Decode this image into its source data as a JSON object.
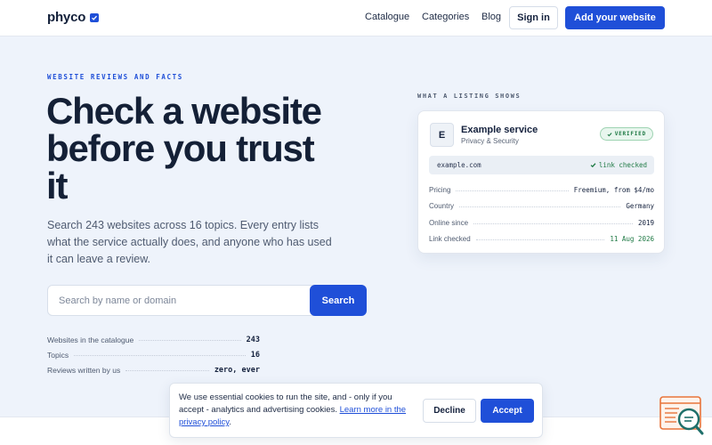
{
  "header": {
    "logo_text": "phyco",
    "nav": [
      "Catalogue",
      "Categories",
      "Blog"
    ],
    "signin_label": "Sign in",
    "add_label": "Add your website"
  },
  "hero": {
    "eyebrow": "WEBSITE REVIEWS AND FACTS",
    "title": "Check a website before you trust it",
    "subtitle": "Search 243 websites across 16 topics. Every entry lists what the service actually does, and anyone who has used it can leave a review.",
    "search_placeholder": "Search by name or domain",
    "search_button": "Search",
    "stats": [
      {
        "label": "Websites in the catalogue",
        "value": "243"
      },
      {
        "label": "Topics",
        "value": "16"
      },
      {
        "label": "Reviews written by us",
        "value": "zero, ever"
      }
    ]
  },
  "listing": {
    "eyebrow": "WHAT A LISTING SHOWS",
    "avatar_letter": "E",
    "name": "Example service",
    "category": "Privacy & Security",
    "badge": "VERIFIED",
    "url": "example.com",
    "url_status": "link checked",
    "facts": [
      {
        "label": "Pricing",
        "value": "Freemium, from $4/mo"
      },
      {
        "label": "Country",
        "value": "Germany"
      },
      {
        "label": "Online since",
        "value": "2019"
      },
      {
        "label": "Link checked",
        "value": "11 Aug 2026"
      }
    ]
  },
  "cookie": {
    "text_before": "We use essential cookies to run the site, and - only if you accept - analytics and advertising cookies. ",
    "link_text": "Learn more in the privacy policy",
    "text_after": ".",
    "decline_label": "Decline",
    "accept_label": "Accept"
  },
  "colors": {
    "accent": "#1f4fd8",
    "verified_green": "#1f7a45",
    "background": "#eef3fb",
    "widget_orange": "#e8743b",
    "widget_teal": "#1e6f6a"
  },
  "icons": {
    "logo_badge": "check-badge-icon",
    "verified": "check-icon",
    "widget": "search-document-icon"
  }
}
